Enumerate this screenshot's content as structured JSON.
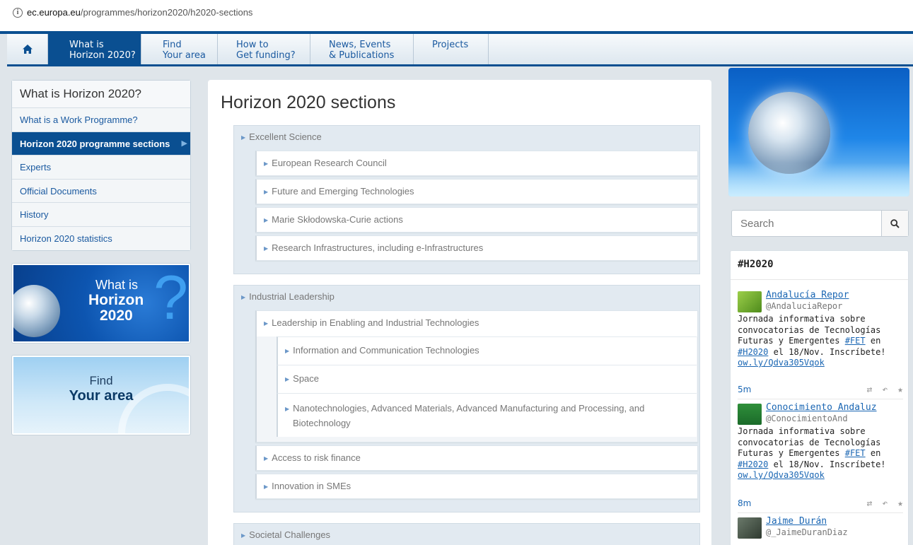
{
  "browser": {
    "url_host": "ec.europa.eu",
    "url_path": "/programmes/horizon2020/h2020-sections"
  },
  "nav": {
    "what_is_line1": "What is",
    "what_is_line2": "Horizon 2020?",
    "find_line1": "Find",
    "find_line2": "Your area",
    "how_line1": "How to",
    "how_line2": "Get funding?",
    "news_line1": "News, Events",
    "news_line2": "& Publications",
    "projects": "Projects"
  },
  "sidebar": {
    "title": "What is Horizon 2020?",
    "items": [
      {
        "label": "What is a Work Programme?"
      },
      {
        "label": "Horizon 2020 programme sections"
      },
      {
        "label": "Experts"
      },
      {
        "label": "Official Documents"
      },
      {
        "label": "History"
      },
      {
        "label": "Horizon 2020 statistics"
      }
    ],
    "promo_what": {
      "line1": "What is",
      "line2": "Horizon",
      "line3": "2020",
      "glyph": "?"
    },
    "promo_find": {
      "line1": "Find",
      "line2": "Your area"
    }
  },
  "main": {
    "title": "Horizon 2020 sections",
    "sections": [
      {
        "label": "Excellent Science",
        "children": [
          {
            "label": "European Research Council"
          },
          {
            "label": "Future and Emerging Technologies"
          },
          {
            "label": "Marie Skłodowska-Curie actions"
          },
          {
            "label": "Research Infrastructures, including e-Infrastructures"
          }
        ]
      },
      {
        "label": "Industrial Leadership",
        "children": [
          {
            "label": "Leadership in Enabling and Industrial Technologies",
            "children": [
              {
                "label": "Information and Communication Technologies"
              },
              {
                "label": "Space"
              },
              {
                "label_line1": "Nanotechnologies, Advanced Materials, Advanced Manufacturing and Processing, and",
                "label_line2": "Biotechnology"
              }
            ]
          },
          {
            "label": "Access to risk finance"
          },
          {
            "label": "Innovation in SMEs"
          }
        ]
      },
      {
        "label": "Societal Challenges"
      }
    ]
  },
  "search": {
    "placeholder": "Search"
  },
  "twitter": {
    "title": "#H2020",
    "tweets": [
      {
        "name": "Andalucía Repor",
        "handle": "@AndaluciaRepor",
        "text_1": "Jornada informativa sobre convocatorias de Tecnologías Futuras y Emergentes ",
        "link_1": "#FET",
        "text_2": " en ",
        "link_2": "#H2020",
        "text_3": " el 18/Nov. Inscríbete! ",
        "link_3": "ow.ly/Qdva305Vqok",
        "time": "5m"
      },
      {
        "name": "Conocimiento Andaluz",
        "handle": "@ConocimientoAnd",
        "text_1": "Jornada informativa sobre convocatorias de Tecnologías Futuras y Emergentes ",
        "link_1": "#FET",
        "text_2": " en ",
        "link_2": "#H2020",
        "text_3": " el 18/Nov. Inscríbete! ",
        "link_3": "ow.ly/Qdva305Vqok",
        "time": "8m"
      },
      {
        "name": "Jaime Durán",
        "handle": "@_JaimeDuranDiaz"
      }
    ]
  },
  "colors": {
    "brand_blue": "#0a4f91",
    "link_blue": "#1b5aa0",
    "section_bg": "#e2eaf1"
  }
}
